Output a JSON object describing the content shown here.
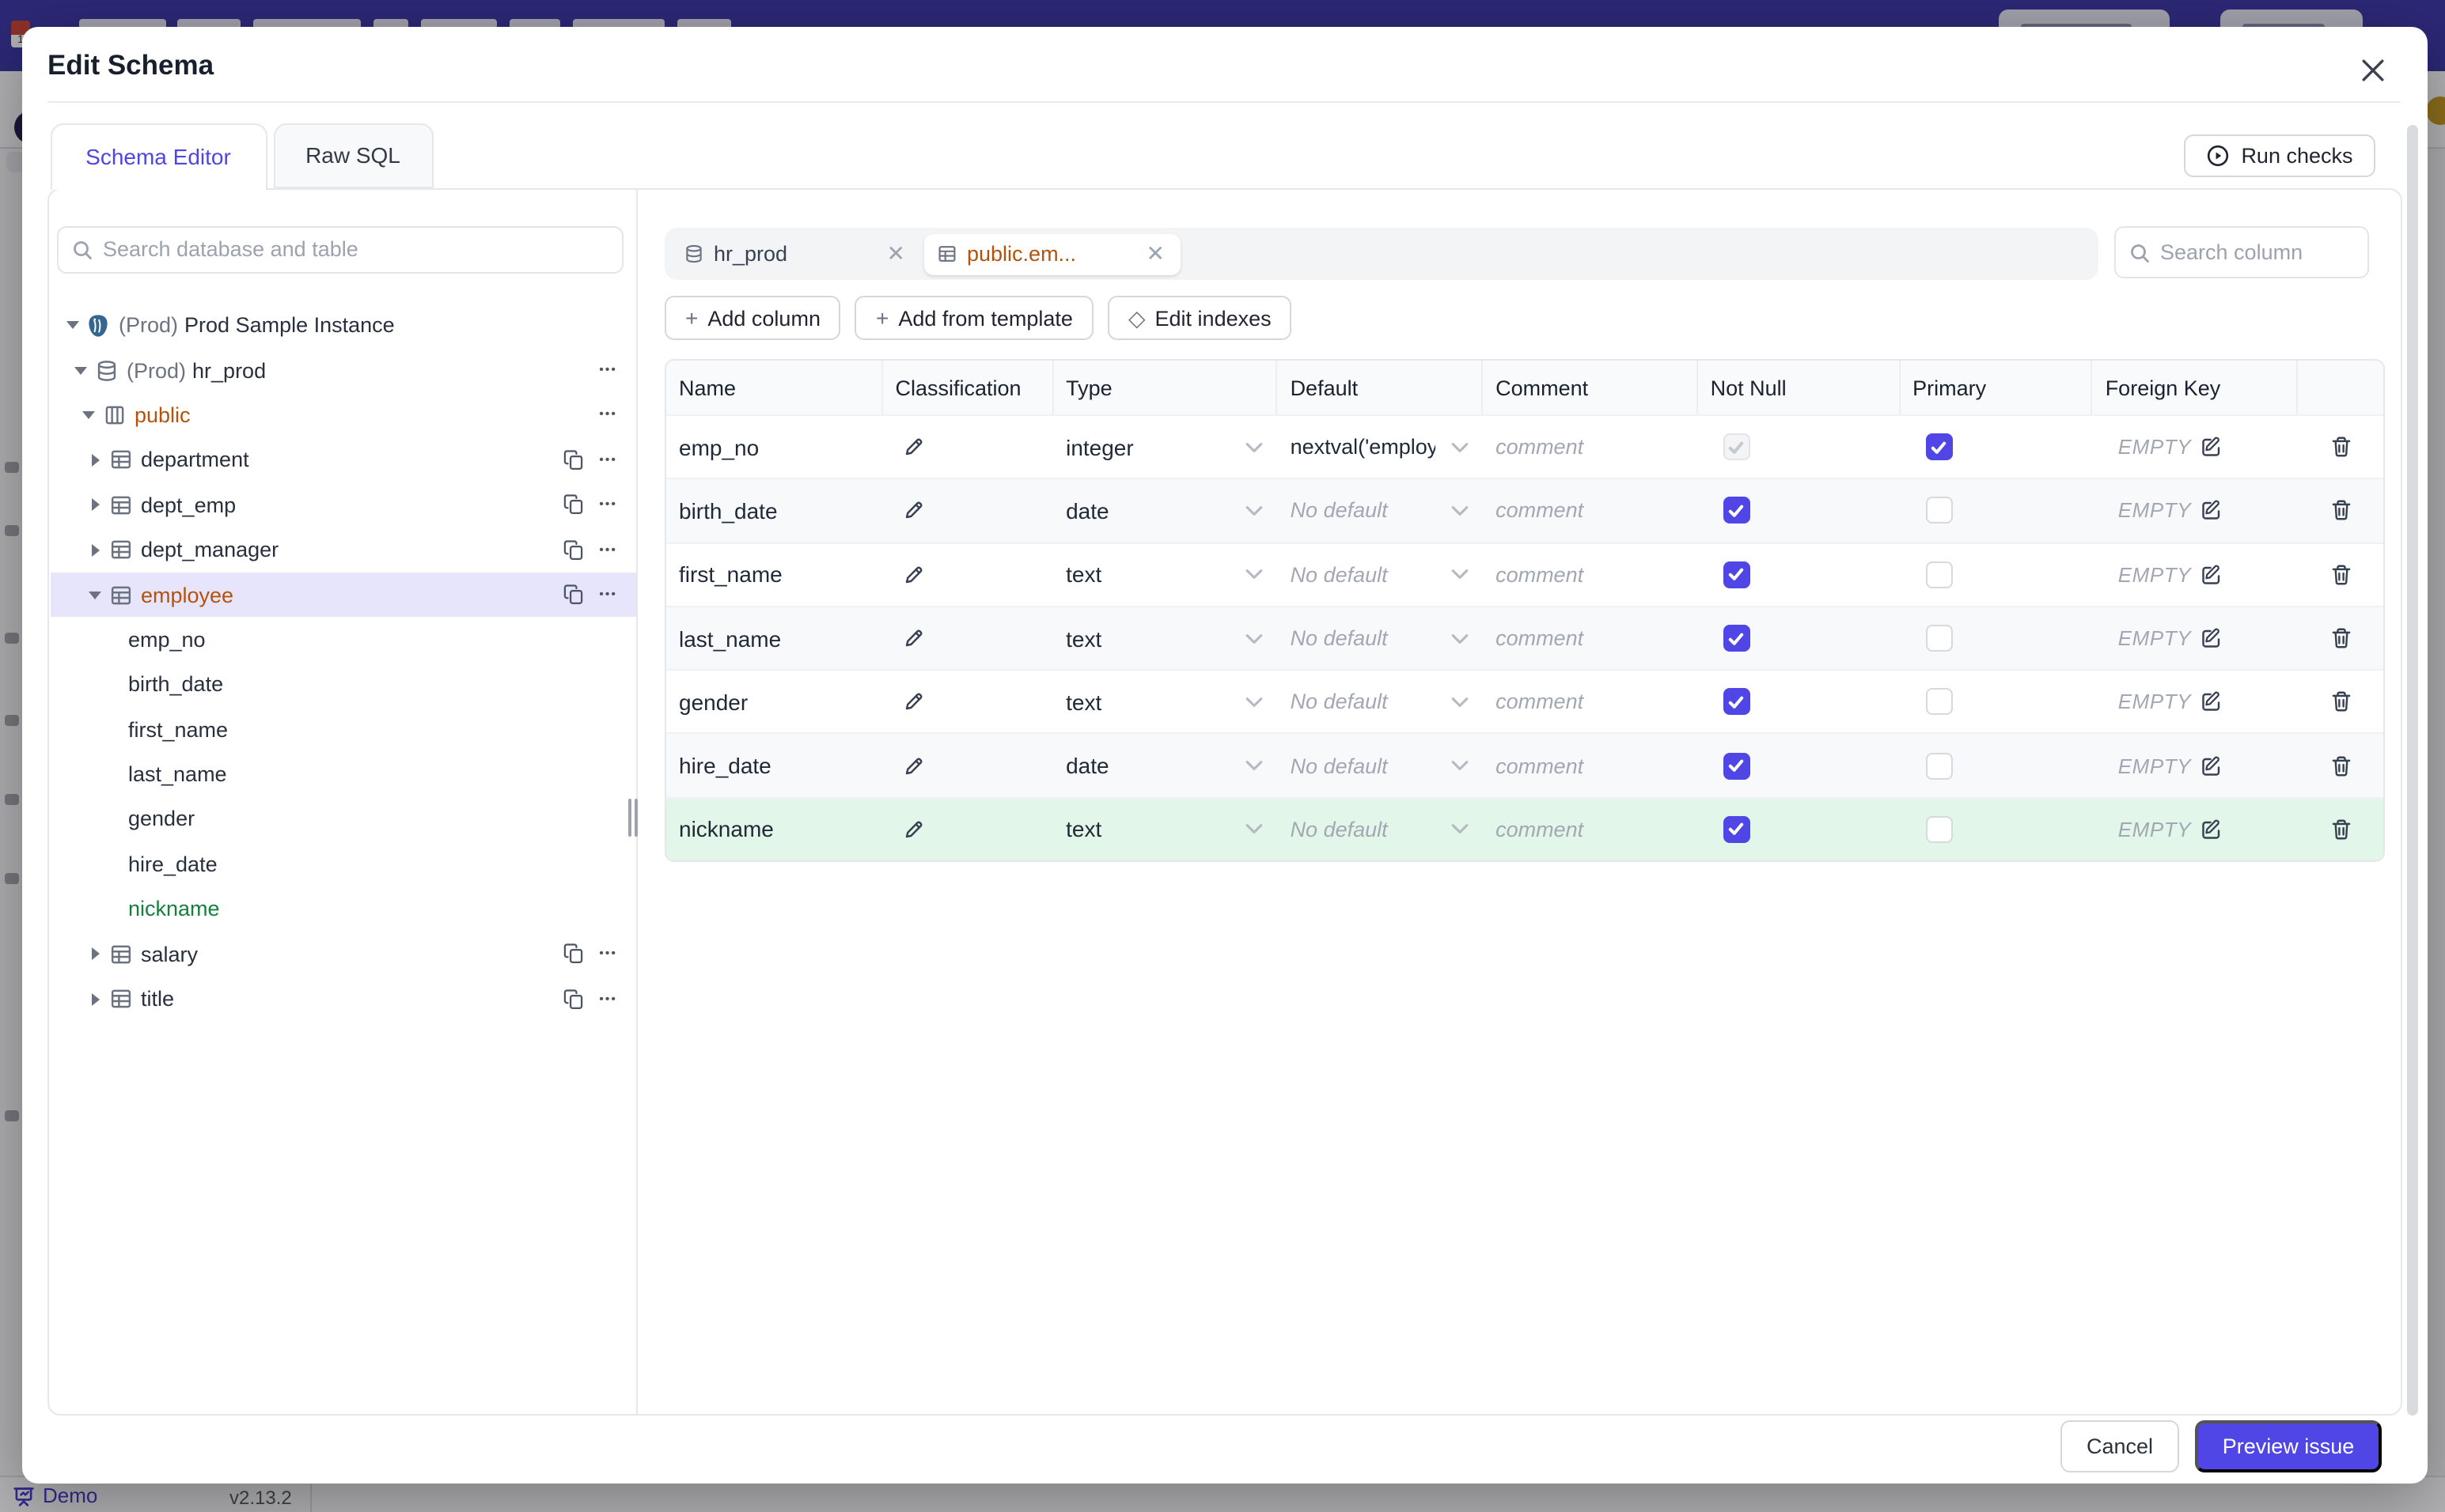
{
  "background": {
    "footer": {
      "demo_label": "Demo",
      "version": "v2.13.2"
    }
  },
  "modal": {
    "title": "Edit Schema",
    "tabs": [
      {
        "label": "Schema Editor",
        "active": true
      },
      {
        "label": "Raw SQL",
        "active": false
      }
    ],
    "run_checks_label": "Run checks",
    "sidebar": {
      "search_placeholder": "Search database and table",
      "tree": [
        {
          "indent": 0,
          "caret": "down",
          "icon": "postgres",
          "prefix": "(Prod)",
          "label": "Prod Sample Instance",
          "color": "default",
          "actions": []
        },
        {
          "indent": 1,
          "caret": "down",
          "icon": "database",
          "prefix": "(Prod)",
          "label": "hr_prod",
          "color": "default",
          "actions": [
            "dots"
          ]
        },
        {
          "indent": 2,
          "caret": "down",
          "icon": "schema",
          "prefix": "",
          "label": "public",
          "color": "amber",
          "actions": [
            "dots"
          ]
        },
        {
          "indent": 3,
          "caret": "right",
          "icon": "table",
          "prefix": "",
          "label": "department",
          "color": "default",
          "actions": [
            "copy",
            "dots"
          ]
        },
        {
          "indent": 3,
          "caret": "right",
          "icon": "table",
          "prefix": "",
          "label": "dept_emp",
          "color": "default",
          "actions": [
            "copy",
            "dots"
          ]
        },
        {
          "indent": 3,
          "caret": "right",
          "icon": "table",
          "prefix": "",
          "label": "dept_manager",
          "color": "default",
          "actions": [
            "copy",
            "dots"
          ]
        },
        {
          "indent": 3,
          "caret": "down",
          "icon": "table",
          "prefix": "",
          "label": "employee",
          "color": "amber",
          "selected": true,
          "actions": [
            "copy",
            "dots"
          ]
        },
        {
          "indent": 4,
          "caret": null,
          "icon": null,
          "prefix": "",
          "label": "emp_no",
          "color": "default",
          "actions": []
        },
        {
          "indent": 4,
          "caret": null,
          "icon": null,
          "prefix": "",
          "label": "birth_date",
          "color": "default",
          "actions": []
        },
        {
          "indent": 4,
          "caret": null,
          "icon": null,
          "prefix": "",
          "label": "first_name",
          "color": "default",
          "actions": []
        },
        {
          "indent": 4,
          "caret": null,
          "icon": null,
          "prefix": "",
          "label": "last_name",
          "color": "default",
          "actions": []
        },
        {
          "indent": 4,
          "caret": null,
          "icon": null,
          "prefix": "",
          "label": "gender",
          "color": "default",
          "actions": []
        },
        {
          "indent": 4,
          "caret": null,
          "icon": null,
          "prefix": "",
          "label": "hire_date",
          "color": "default",
          "actions": []
        },
        {
          "indent": 4,
          "caret": null,
          "icon": null,
          "prefix": "",
          "label": "nickname",
          "color": "green",
          "actions": []
        },
        {
          "indent": 3,
          "caret": "right",
          "icon": "table",
          "prefix": "",
          "label": "salary",
          "color": "default",
          "actions": [
            "copy",
            "dots"
          ]
        },
        {
          "indent": 3,
          "caret": "right",
          "icon": "table",
          "prefix": "",
          "label": "title",
          "color": "default",
          "actions": [
            "copy",
            "dots"
          ]
        }
      ]
    },
    "editor": {
      "chips": [
        {
          "icon": "database",
          "label": "hr_prod",
          "active": false
        },
        {
          "icon": "table",
          "label": "public.em...",
          "active": true
        }
      ],
      "column_search_placeholder": "Search column",
      "toolbar": [
        {
          "icon": "plus",
          "label": "Add column"
        },
        {
          "icon": "plus",
          "label": "Add from template"
        },
        {
          "icon": "diamond",
          "label": "Edit indexes"
        }
      ],
      "table": {
        "headers": [
          "Name",
          "Classification",
          "Type",
          "Default",
          "Comment",
          "Not Null",
          "Primary",
          "Foreign Key",
          ""
        ],
        "comment_placeholder": "comment",
        "fk_placeholder": "EMPTY",
        "rows": [
          {
            "name": "emp_no",
            "type": "integer",
            "default": "nextval('employ",
            "default_is_placeholder": false,
            "not_null": "disabled-checked",
            "primary": true,
            "highlight": false
          },
          {
            "name": "birth_date",
            "type": "date",
            "default": "No default",
            "default_is_placeholder": true,
            "not_null": "checked",
            "primary": false,
            "highlight": false
          },
          {
            "name": "first_name",
            "type": "text",
            "default": "No default",
            "default_is_placeholder": true,
            "not_null": "checked",
            "primary": false,
            "highlight": false
          },
          {
            "name": "last_name",
            "type": "text",
            "default": "No default",
            "default_is_placeholder": true,
            "not_null": "checked",
            "primary": false,
            "highlight": false
          },
          {
            "name": "gender",
            "type": "text",
            "default": "No default",
            "default_is_placeholder": true,
            "not_null": "checked",
            "primary": false,
            "highlight": false
          },
          {
            "name": "hire_date",
            "type": "date",
            "default": "No default",
            "default_is_placeholder": true,
            "not_null": "checked",
            "primary": false,
            "highlight": false
          },
          {
            "name": "nickname",
            "type": "text",
            "default": "No default",
            "default_is_placeholder": true,
            "not_null": "checked",
            "primary": false,
            "highlight": true
          }
        ]
      }
    },
    "footer": {
      "cancel_label": "Cancel",
      "submit_label": "Preview issue"
    }
  },
  "colors": {
    "accent": "#4f46e5",
    "amber": "#b45309",
    "green": "#15803d",
    "topbar": "#3c35a5",
    "row_highlight_green": "#e2f6e9",
    "tree_highlight_indigo": "#e7e5fc"
  }
}
